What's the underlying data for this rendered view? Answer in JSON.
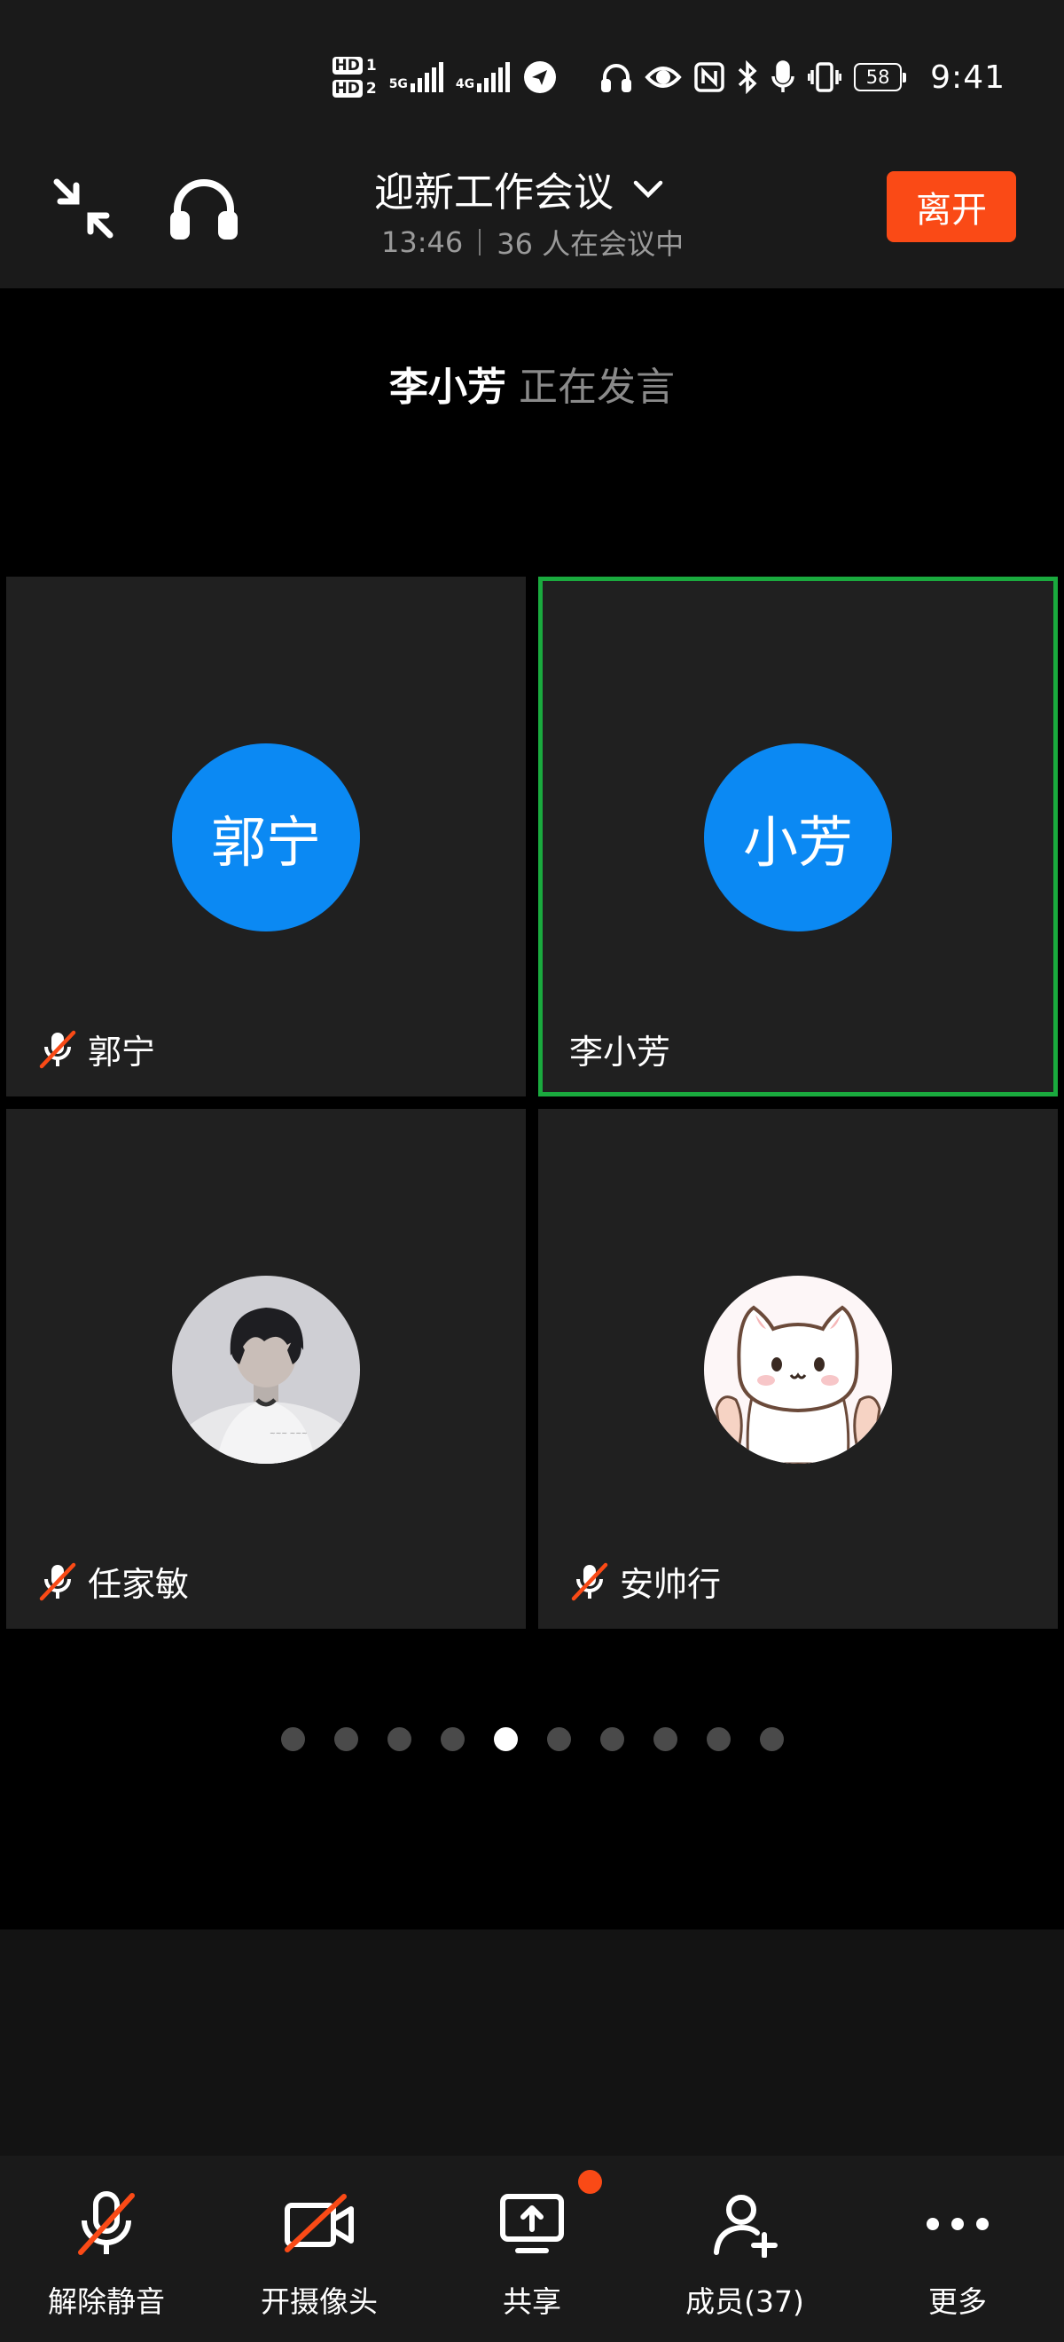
{
  "status_bar": {
    "sim1_label": "HD",
    "sim1_num": "1",
    "sim2_label": "HD",
    "sim2_num": "2",
    "net1": "5G",
    "net2": "4G",
    "battery": "58",
    "time": "9:41"
  },
  "header": {
    "title": "迎新工作会议",
    "elapsed": "13:46",
    "participants_text": "36 人在会议中",
    "leave_label": "离开"
  },
  "speaker": {
    "name": "李小芳",
    "status": "正在发言"
  },
  "tiles": [
    {
      "avatar_text": "郭宁",
      "name": "郭宁",
      "muted": true
    },
    {
      "avatar_text": "小芳",
      "name": "李小芳",
      "muted": false,
      "active": true
    },
    {
      "avatar_text": "",
      "name": "任家敏",
      "muted": true
    },
    {
      "avatar_text": "",
      "name": "安帅行",
      "muted": true
    }
  ],
  "pagination": {
    "total": 10,
    "current": 5
  },
  "toolbar": {
    "unmute_label": "解除静音",
    "camera_label": "开摄像头",
    "share_label": "共享",
    "members_label": "成员(37)",
    "more_label": "更多"
  },
  "colors": {
    "accent_orange": "#fa4a16",
    "avatar_blue": "#0b89f3",
    "active_border": "#1aaa3e"
  }
}
